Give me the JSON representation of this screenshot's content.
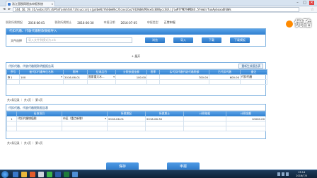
{
  "browser": {
    "tab_title": "浙江国税网税务申报系统",
    "url": "144.16.19.31/wsbs/bTc/bPtmTaskhtml?zhiucccnjsjpdbeNiYhS0eWhcJCcoxLCwzY4JNdWcMOnxXc8XNyccSbl|jlwM7YMDYHMDEX.5Yem3/fuoAyGoxaOhOWs",
    "close_label": "x",
    "win_min": "–",
    "win_max": "□",
    "win_close": "✕",
    "back": "◄",
    "forward": "►",
    "star": "☆"
  },
  "info_row": {
    "a_label": "税款所属期起",
    "a_value": "2016-06-01",
    "b_label": "税款所属期止",
    "b_value": "2016-06-30",
    "c_label": "申报日期",
    "c_value": "2016-07-05",
    "d_label": "申报类型",
    "d_value": "正常申报"
  },
  "upload_section": {
    "title": "代扣代缴、代收代缴税款数据导入",
    "file_label": "文件选择",
    "file_placeholder": "导入文件到模式为.xls",
    "buttons": [
      "浏览",
      "导入",
      "下载",
      "下载模板"
    ]
  },
  "expand": {
    "label": "展开",
    "icon": "+"
  },
  "table1": {
    "title": "代扣代缴、代收代缴税款明细报告表",
    "action_button": "重新生成报告表",
    "headers": [
      "序号",
      "被代扣代缴单位名称",
      "税种",
      "征收品目",
      "计税依据金额",
      "税率",
      "实代扣代缴代收代缴税额",
      "已代扣代缴",
      "备注"
    ],
    "rows": [
      [
        "1",
        "100",
        "2016-06-01",
        "国家重大水...",
        "100.00",
        "",
        "700.00",
        "600.00",
        "代扣代缴"
      ]
    ],
    "pager": "共1条记录 ｜ 共1页 ｜ 第1页"
  },
  "table2": {
    "title": "代扣代缴、代收代缴税款报告表",
    "headers": [
      "",
      "征收项目",
      "所属期起",
      "所属期止",
      "计税依据",
      "计税金额"
    ],
    "rows": [
      [
        "1",
        "代扣代缴增值税",
        "市区（重点新增）",
        "2016-06-01",
        "2016-06-30",
        "",
        "10000.00"
      ]
    ],
    "pager": "共1条记录 ｜ 共1页 ｜ 第1页"
  },
  "modal_buttons": {
    "save": "保存",
    "submit": "申报"
  },
  "taskbar": {
    "time": "13:14",
    "date": "2016/7/5"
  },
  "watermark": {
    "text": "优酷"
  },
  "colors": {
    "header_blue": "#2f7fcf",
    "button_blue": "#2a75c4",
    "taskbar": "#0f2338"
  }
}
